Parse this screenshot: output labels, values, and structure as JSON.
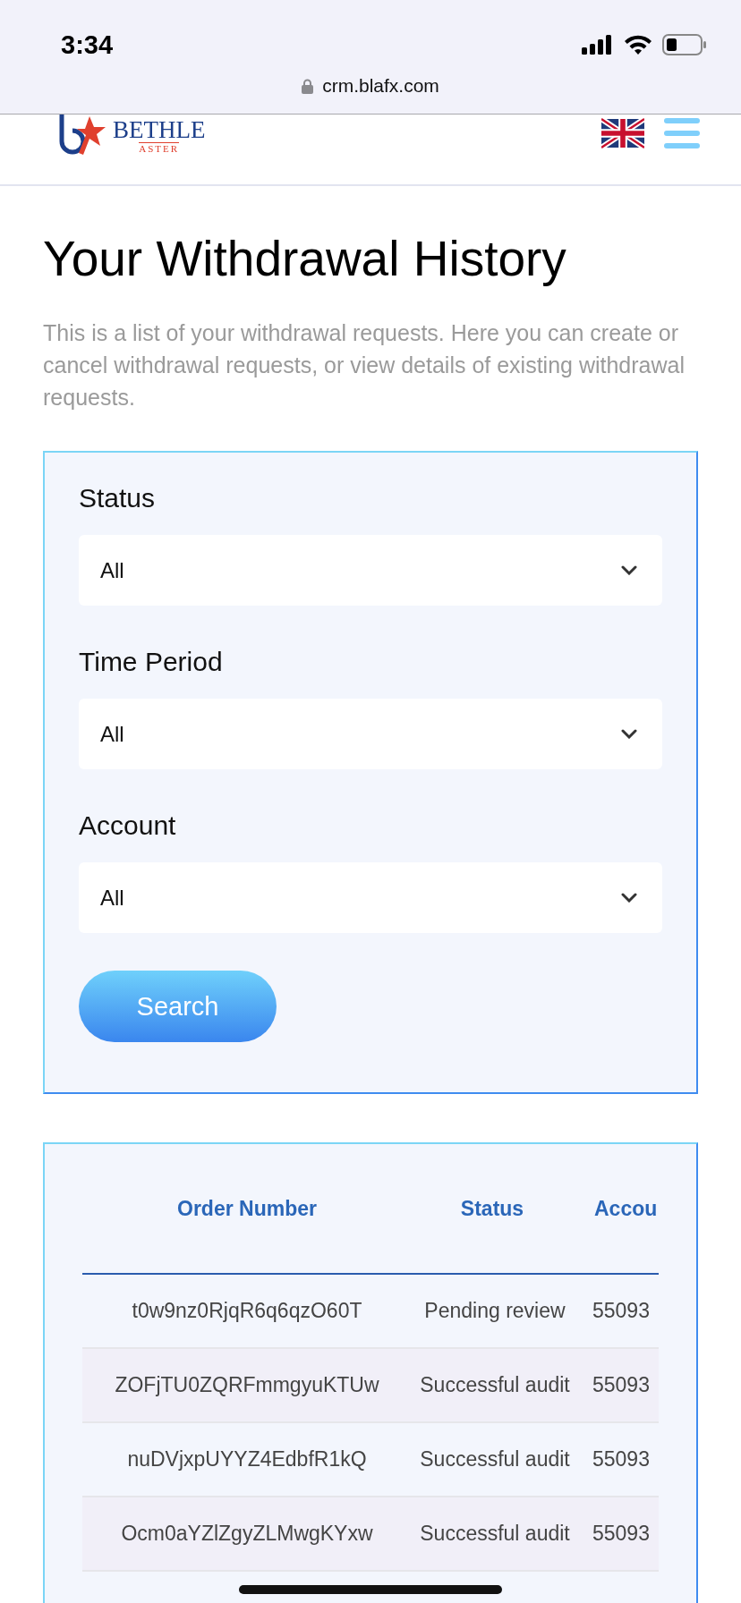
{
  "status_bar": {
    "time": "3:34",
    "url": "crm.blafx.com"
  },
  "header": {
    "logo_text": "BETHLE",
    "logo_subtext": "ASTER"
  },
  "page": {
    "title": "Your Withdrawal History",
    "description": "This is a list of your withdrawal requests. Here you can create or cancel withdrawal requests, or view details of existing withdrawal requests."
  },
  "filters": [
    {
      "label": "Status",
      "value": "All"
    },
    {
      "label": "Time Period",
      "value": "All"
    },
    {
      "label": "Account",
      "value": "All"
    }
  ],
  "search_button": "Search",
  "table": {
    "columns": [
      "Order Number",
      "Status",
      "Accou"
    ],
    "rows": [
      [
        "t0w9nz0RjqR6q6qzO60T",
        "Pending review",
        "55093"
      ],
      [
        "ZOFjTU0ZQRFmmgyuKTUw",
        "Successful audit",
        "55093"
      ],
      [
        "nuDVjxpUYYZ4EdbfR1kQ",
        "Successful audit",
        "55093"
      ],
      [
        "Ocm0aYZlZgyZLMwgKYxw",
        "Successful audit",
        "55093"
      ]
    ]
  }
}
